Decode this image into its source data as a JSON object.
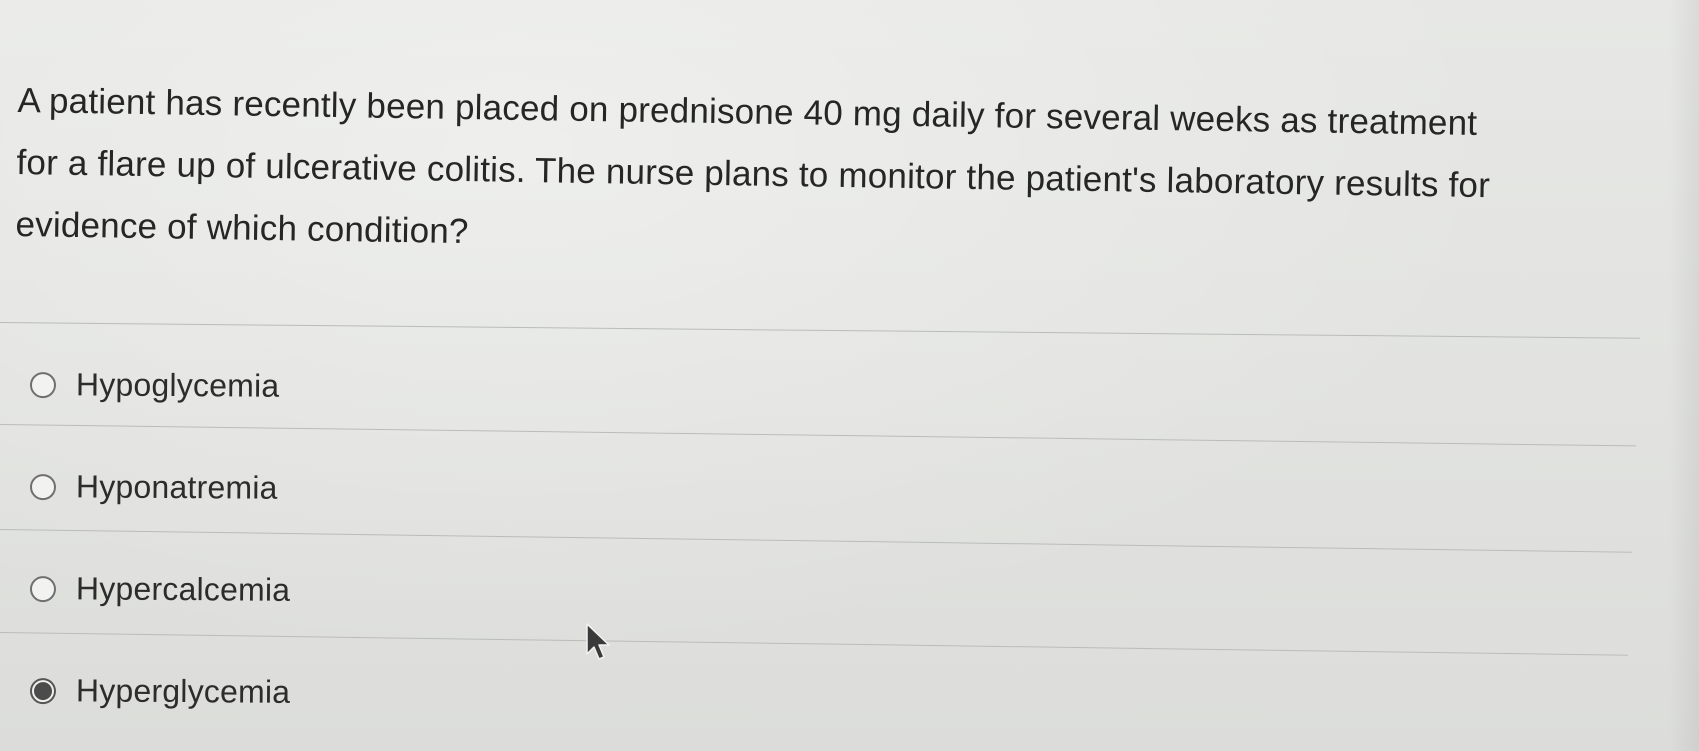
{
  "question": {
    "text": "A patient has recently been placed on prednisone 40 mg daily for several weeks as treatment for a flare up of ulcerative colitis. The nurse plans to monitor the patient's laboratory results for evidence of which condition?"
  },
  "options": [
    {
      "label": "Hypoglycemia",
      "selected": false
    },
    {
      "label": "Hyponatremia",
      "selected": false
    },
    {
      "label": "Hypercalcemia",
      "selected": false
    },
    {
      "label": "Hyperglycemia",
      "selected": true
    }
  ],
  "icons": {
    "radio_unselected": "radio-empty-icon",
    "radio_selected": "radio-filled-icon",
    "cursor": "mouse-pointer-icon"
  },
  "colors": {
    "background": "#e3e4e1",
    "text": "#262626",
    "divider": "#b9bdb8",
    "radio_fill": "#4b4b4b"
  }
}
